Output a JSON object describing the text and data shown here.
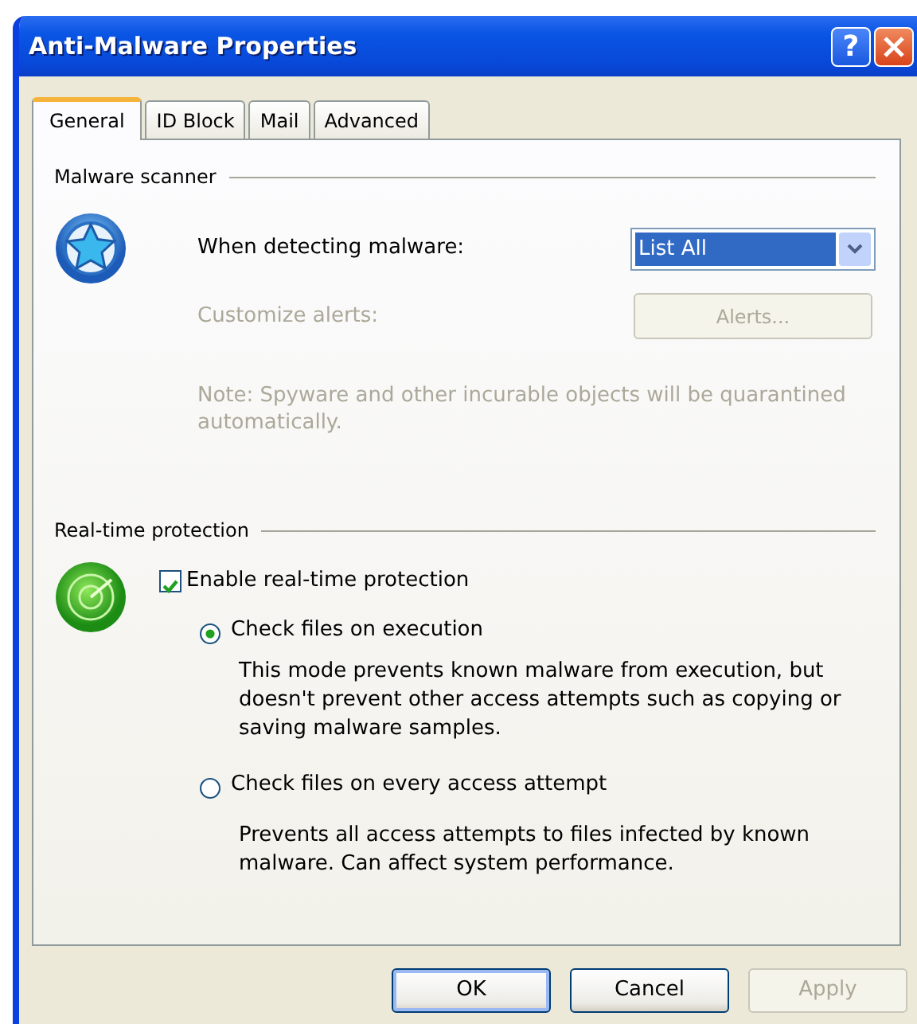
{
  "window": {
    "title": "Anti-Malware Properties",
    "help_button": "?"
  },
  "tabs": [
    {
      "label": "General",
      "selected": true
    },
    {
      "label": "ID Block",
      "selected": false
    },
    {
      "label": "Mail",
      "selected": false
    },
    {
      "label": "Advanced",
      "selected": false
    }
  ],
  "malware_scanner": {
    "heading": "Malware scanner",
    "action_label": "When detecting malware:",
    "action_value": "List All",
    "customize": {
      "label": "Customize alerts:",
      "button": "Alerts...",
      "disabled": true
    },
    "note": "Note: Spyware and other incurable objects will be quarantined automatically."
  },
  "realtime": {
    "heading": "Real-time protection",
    "enable": {
      "label": "Enable real-time protection",
      "checked": true
    },
    "modes": [
      {
        "label": "Check files on execution",
        "selected": true,
        "description": "This mode prevents known malware from execution, but doesn't prevent other access attempts such as copying or saving malware samples."
      },
      {
        "label": "Check files on every access attempt",
        "selected": false,
        "description": "Prevents all access attempts to files infected by known malware. Can affect system performance."
      }
    ]
  },
  "buttons": [
    {
      "label": "OK",
      "default": true,
      "disabled": false
    },
    {
      "label": "Cancel",
      "default": false,
      "disabled": false
    },
    {
      "label": "Apply",
      "default": false,
      "disabled": true
    }
  ]
}
